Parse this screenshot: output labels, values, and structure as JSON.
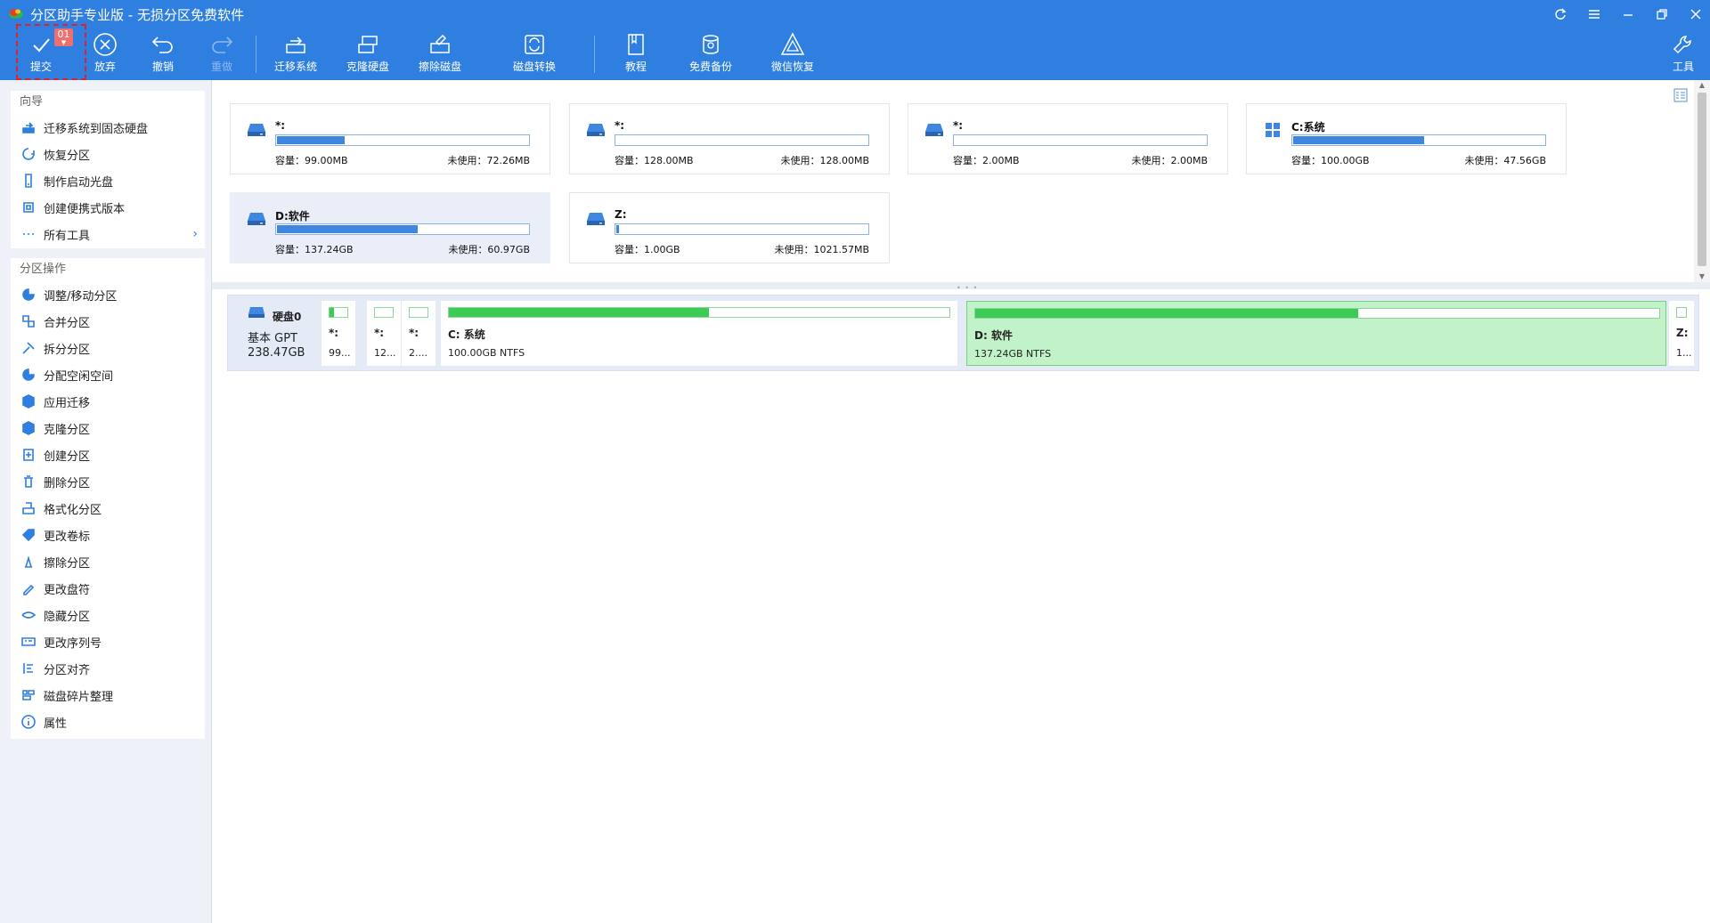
{
  "window": {
    "title": "分区助手专业版 - 无损分区免费软件"
  },
  "toolbar": {
    "commit": "提交",
    "commit_badge": "01",
    "discard": "放弃",
    "undo": "撤销",
    "redo": "重做",
    "migrate_os": "迁移系统",
    "clone_disk": "克隆硬盘",
    "wipe_disk": "擦除磁盘",
    "disk_convert": "磁盘转换",
    "tutorial": "教程",
    "free_backup": "免费备份",
    "wechat_recovery": "微信恢复",
    "tools": "工具"
  },
  "sidebar": {
    "wizard": {
      "title": "向导",
      "items": [
        {
          "label": "迁移系统到固态硬盘",
          "icon": "migrate-ssd-icon"
        },
        {
          "label": "恢复分区",
          "icon": "recover-partition-icon"
        },
        {
          "label": "制作启动光盘",
          "icon": "bootable-media-icon"
        },
        {
          "label": "创建便携式版本",
          "icon": "portable-version-icon"
        },
        {
          "label": "所有工具",
          "icon": "all-tools-icon"
        }
      ]
    },
    "operations": {
      "title": "分区操作",
      "items": [
        {
          "label": "调整/移动分区",
          "icon": "resize-move-icon"
        },
        {
          "label": "合并分区",
          "icon": "merge-icon"
        },
        {
          "label": "拆分分区",
          "icon": "split-icon"
        },
        {
          "label": "分配空闲空间",
          "icon": "allocate-space-icon"
        },
        {
          "label": "应用迁移",
          "icon": "app-mover-icon"
        },
        {
          "label": "克隆分区",
          "icon": "clone-partition-icon"
        },
        {
          "label": "创建分区",
          "icon": "create-partition-icon"
        },
        {
          "label": "删除分区",
          "icon": "delete-partition-icon"
        },
        {
          "label": "格式化分区",
          "icon": "format-icon"
        },
        {
          "label": "更改卷标",
          "icon": "label-icon"
        },
        {
          "label": "擦除分区",
          "icon": "wipe-icon"
        },
        {
          "label": "更改盘符",
          "icon": "drive-letter-icon"
        },
        {
          "label": "隐藏分区",
          "icon": "hide-icon"
        },
        {
          "label": "更改序列号",
          "icon": "serial-number-icon"
        },
        {
          "label": "分区对齐",
          "icon": "align-icon"
        },
        {
          "label": "磁盘碎片整理",
          "icon": "defrag-icon"
        },
        {
          "label": "属性",
          "icon": "info-icon"
        }
      ]
    }
  },
  "partition_cards": [
    {
      "name": "*:",
      "capacity": "容量：99.00MB",
      "free": "未使用：72.26MB",
      "used_fraction": 0.27,
      "icon": "drive-icon"
    },
    {
      "name": "*:",
      "capacity": "容量：128.00MB",
      "free": "未使用：128.00MB",
      "used_fraction": 0.0,
      "icon": "drive-icon"
    },
    {
      "name": "*:",
      "capacity": "容量：2.00MB",
      "free": "未使用：2.00MB",
      "used_fraction": 0.0,
      "icon": "drive-icon"
    },
    {
      "name": "C:系统",
      "capacity": "容量：100.00GB",
      "free": "未使用：47.56GB",
      "used_fraction": 0.52,
      "icon": "windows-icon"
    },
    {
      "name": "D:软件",
      "capacity": "容量：137.24GB",
      "free": "未使用：60.97GB",
      "used_fraction": 0.56,
      "icon": "drive-icon",
      "selected": true
    },
    {
      "name": "Z:",
      "capacity": "容量：1.00GB",
      "free": "未使用：1021.57MB",
      "used_fraction": 0.01,
      "icon": "drive-icon"
    }
  ],
  "disk": {
    "name": "硬盘0",
    "type": "基本 GPT",
    "size": "238.47GB",
    "partitions": [
      {
        "name": "*:",
        "desc": "99...",
        "used_fraction": 0.27
      },
      {
        "name": "*:",
        "desc": "12...",
        "used_fraction": 0.0
      },
      {
        "name": "*:",
        "desc": "2....",
        "used_fraction": 0.0
      },
      {
        "name": "C: 系统",
        "desc": "100.00GB NTFS",
        "used_fraction": 0.52
      },
      {
        "name": "D: 软件",
        "desc": "137.24GB NTFS",
        "used_fraction": 0.56,
        "selected": true
      },
      {
        "name": "Z:",
        "desc": "1...",
        "used_fraction": 0.0
      }
    ]
  },
  "colors": {
    "accent": "#2e7fdf",
    "usage_bar": "#3f86e0",
    "partition_used": "#3ccb55",
    "selected_partition": "#c1f2c8",
    "highlight_border": "#e0202a"
  }
}
